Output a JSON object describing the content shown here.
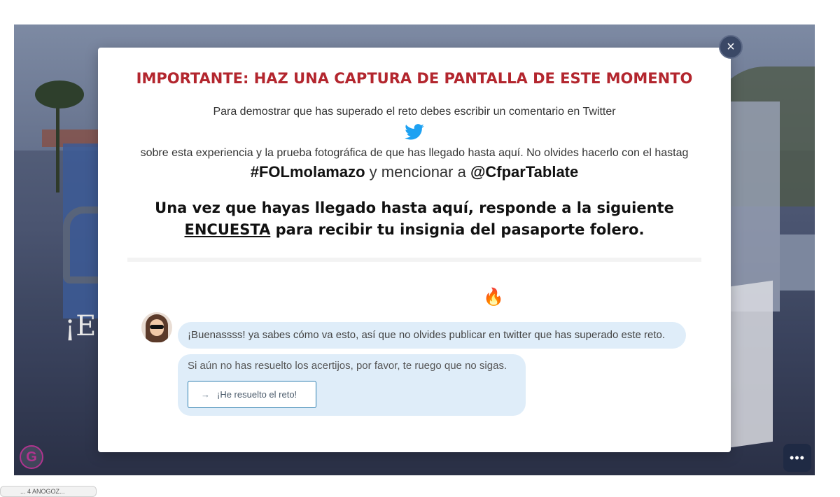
{
  "modal": {
    "headline": "IMPORTANTE: HAZ UNA CAPTURA DE PANTALLA DE ESTE MOMENTO",
    "line1": "Para demostrar que has superado el reto debes escribir un comentario en Twitter",
    "line2": "sobre esta experiencia y la prueba fotográfica de que has llegado hasta aquí. No olvides hacerlo con el hastag",
    "hashtag": "#FOLmolamazo",
    "mention_connector": " y mencionar a ",
    "mention": "@CfparTablate",
    "big_text_pre": "Una vez que hayas llegado hasta aquí, responde a la siguiente ",
    "big_text_link": "ENCUESTA",
    "big_text_post": " para recibir tu insignia del pasaporte folero.",
    "close_label": "×"
  },
  "chat": {
    "fire_emoji": "🔥",
    "message1": "¡Buenassss! ya sabes cómo va esto, así que no olvides publicar en twitter que has superado este reto.",
    "message2": "Si aún no has resuelto los acertijos, por favor, te ruego que no sigas.",
    "button_arrow": "→",
    "button_label": "¡He resuelto el reto!"
  },
  "widgets": {
    "logo_letter": "G",
    "more_label": "•••",
    "tooltip_text": "... 4 ANOGOZ..."
  },
  "colors": {
    "headline": "#b3262e",
    "twitter": "#1da1f2",
    "bubble": "#dfedf9",
    "button_border": "#2f7fb0"
  },
  "icons": [
    "twitter-icon",
    "close-icon",
    "arrow-right-icon",
    "more-icon",
    "fire-icon"
  ]
}
